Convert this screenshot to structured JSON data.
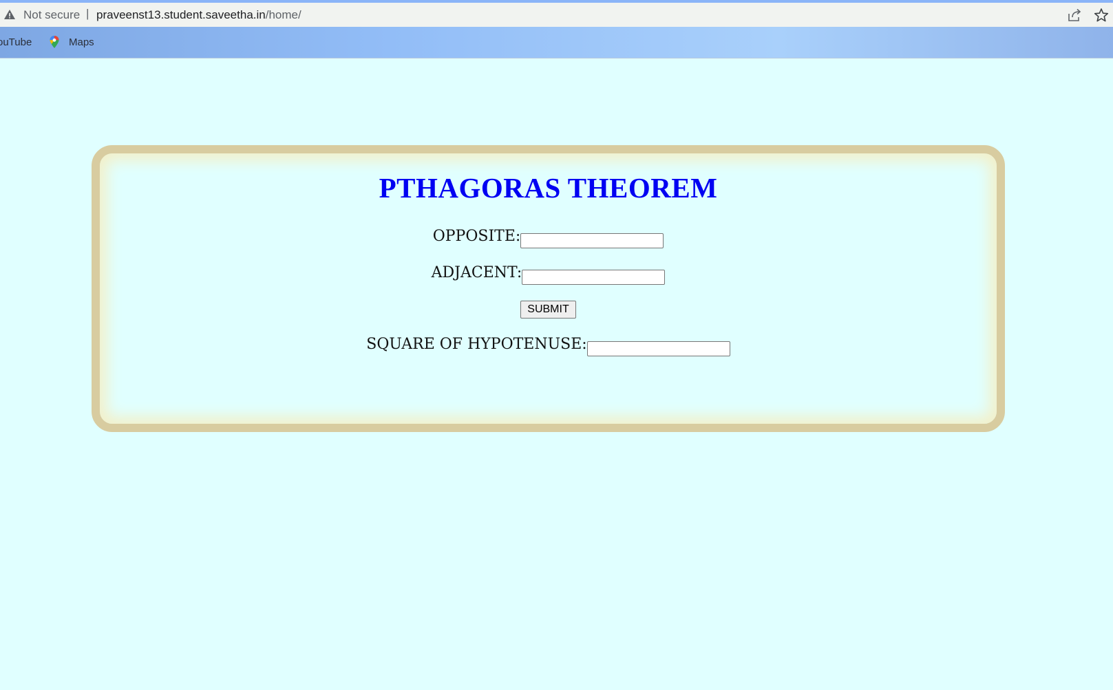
{
  "browser": {
    "security_label": "Not secure",
    "separator": "|",
    "url_host": "praveenst13.student.saveetha.in",
    "url_path": "/home/",
    "bookmarks": [
      {
        "label": "ouTube",
        "icon": "youtube-icon"
      },
      {
        "label": "Maps",
        "icon": "maps-icon"
      }
    ]
  },
  "form": {
    "title": "PTHAGORAS THEOREM",
    "opposite_label": "OPPOSITE:",
    "opposite_value": "",
    "adjacent_label": "ADJACENT:",
    "adjacent_value": "",
    "submit_label": "SUBMIT",
    "hypotenuse_label": "SQUARE OF HYPOTENUSE:",
    "hypotenuse_value": ""
  },
  "colors": {
    "page_background": "#e0ffff",
    "card_border": "#d8cca0",
    "title": "#0000f2"
  }
}
